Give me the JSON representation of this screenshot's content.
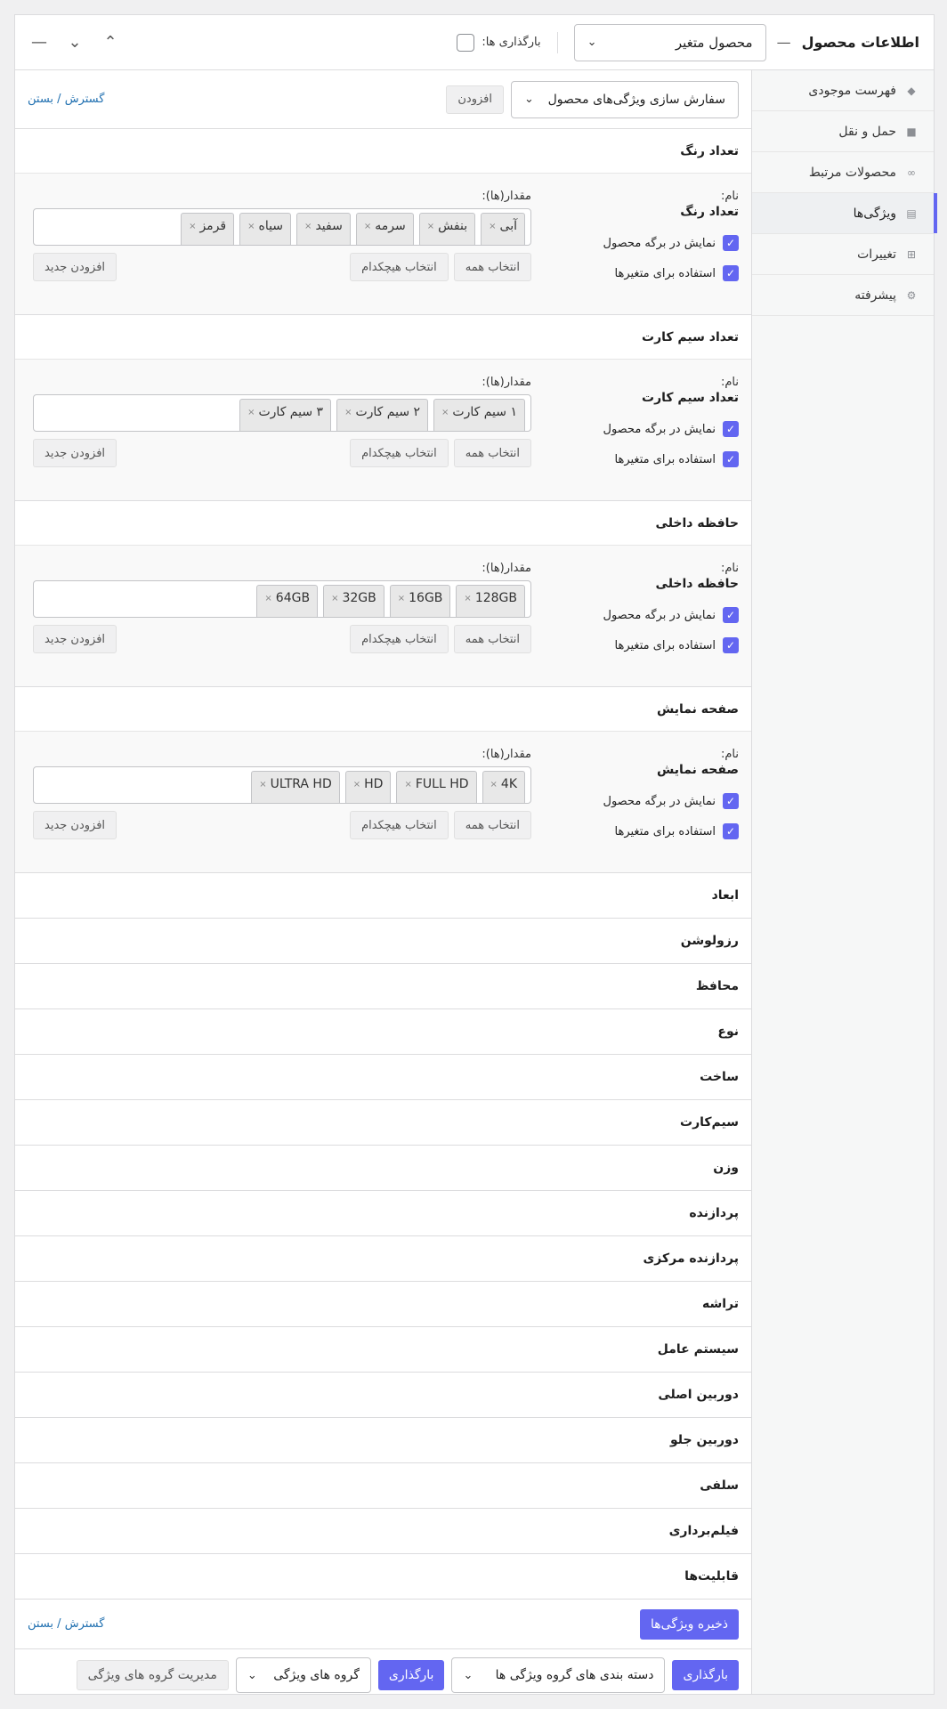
{
  "header": {
    "title": "اطلاعات محصول",
    "dash": "—",
    "product_type": "محصول متغیر",
    "downloads_label": "بارگذاری ها:",
    "btn_up": "⌃",
    "btn_down": "⌄",
    "btn_collapse": "—"
  },
  "tabs": [
    {
      "label": "فهرست موجودی",
      "icon": "tag-icon"
    },
    {
      "label": "حمل و نقل",
      "icon": "truck-icon"
    },
    {
      "label": "محصولات مرتبط",
      "icon": "link-icon"
    },
    {
      "label": "ویژگی‌ها",
      "icon": "list-icon"
    },
    {
      "label": "تغییرات",
      "icon": "grid-icon"
    },
    {
      "label": "پیشرفته",
      "icon": "gear-icon"
    }
  ],
  "toolbar": {
    "attr_select": "سفارش سازی ویژگی‌های محصول",
    "add_label": "افزودن",
    "expand": "گسترش",
    "sep": " / ",
    "close": "بستن"
  },
  "labels": {
    "name": "نام:",
    "values": "مقدار(ها):",
    "visible": "نمایش در برگه محصول",
    "variation": "استفاده برای متغیرها",
    "select_all": "انتخاب همه",
    "select_none": "انتخاب هیچکدام",
    "add_new": "افزودن جدید"
  },
  "attributes": [
    {
      "name": "تعداد رنگ",
      "values": [
        "آبی",
        "بنفش",
        "سرمه",
        "سفید",
        "سیاه",
        "قرمز"
      ]
    },
    {
      "name": "تعداد سیم کارت",
      "values": [
        "۱ سیم کارت",
        "۲ سیم کارت",
        "۳ سیم کارت"
      ]
    },
    {
      "name": "حافظه داخلی",
      "values": [
        "128GB",
        "16GB",
        "32GB",
        "64GB"
      ]
    },
    {
      "name": "صفحه نمایش",
      "values": [
        "4K",
        "FULL HD",
        "HD",
        "ULTRA HD"
      ]
    }
  ],
  "collapsed": [
    "ابعاد",
    "رزولوشن",
    "محافظ",
    "نوع",
    "ساخت",
    "سیم‌کارت",
    "وزن",
    "پردازنده",
    "پردازنده مرکزی",
    "تراشه",
    "سیستم عامل",
    "دوربین اصلی",
    "دوربین جلو",
    "سلفی",
    "فیلم‌برداری",
    "قابلیت‌ها"
  ],
  "footer": {
    "save": "ذخیره ویژگی‌ها",
    "load1": "بارگذاری",
    "category_select": "دسته بندی های گروه ویژگی ها",
    "load2": "بارگذاری",
    "group_select": "گروه های ویژگی",
    "manage": "مدیریت گروه های ویژگی"
  },
  "colors": {
    "accent": "#6366f1",
    "link": "#2271b1"
  }
}
